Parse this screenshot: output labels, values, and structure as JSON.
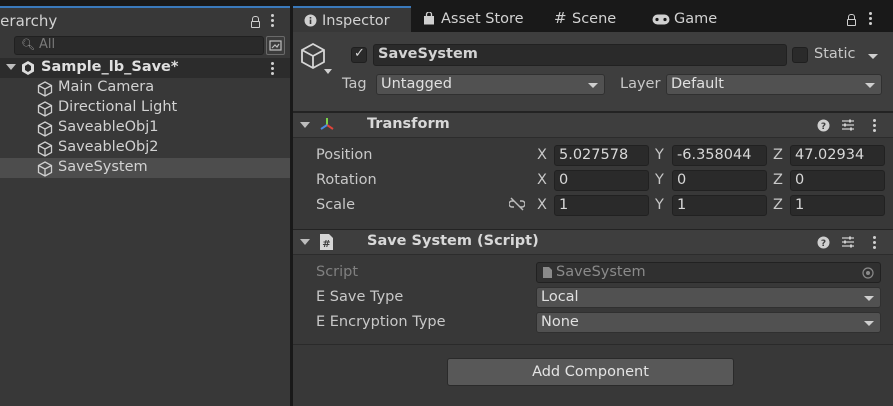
{
  "hierarchy": {
    "tab_label": "ierarchy",
    "search_placeholder": "All",
    "scene": {
      "name": "Sample_lb_Save*"
    },
    "items": [
      {
        "label": "Main Camera"
      },
      {
        "label": "Directional Light"
      },
      {
        "label": "SaveableObj1"
      },
      {
        "label": "SaveableObj2"
      },
      {
        "label": "SaveSystem",
        "selected": true
      }
    ]
  },
  "inspector": {
    "tabs": [
      {
        "label": "Inspector",
        "icon": "info-icon",
        "active": true
      },
      {
        "label": "Asset Store",
        "icon": "bag-icon"
      },
      {
        "label": "Scene",
        "icon": "grid-icon"
      },
      {
        "label": "Game",
        "icon": "gamepad-icon"
      }
    ],
    "gameobject": {
      "active": true,
      "name": "SaveSystem",
      "static_label": "Static",
      "tag_label": "Tag",
      "tag_value": "Untagged",
      "layer_label": "Layer",
      "layer_value": "Default"
    },
    "transform": {
      "title": "Transform",
      "rows": [
        {
          "label": "Position",
          "x": "5.027578",
          "y": "-6.358044",
          "z": "47.02934"
        },
        {
          "label": "Rotation",
          "x": "0",
          "y": "0",
          "z": "0"
        },
        {
          "label": "Scale",
          "x": "1",
          "y": "1",
          "z": "1"
        }
      ],
      "axis_x": "X",
      "axis_y": "Y",
      "axis_z": "Z"
    },
    "save_system": {
      "title": "Save System (Script)",
      "script_label": "Script",
      "script_value": "SaveSystem",
      "save_type_label": "E Save Type",
      "save_type_value": "Local",
      "encryption_label": "E Encryption Type",
      "encryption_value": "None"
    },
    "add_component_label": "Add Component"
  },
  "colors": {
    "accent": "#3a79bb",
    "panel_bg": "#383838",
    "field_bg": "#2a2a2a",
    "selected_row": "#4d4d4d",
    "transform_icon_red": "#e0443a",
    "transform_icon_green": "#7bd44a",
    "transform_icon_blue": "#4a8ae0"
  }
}
